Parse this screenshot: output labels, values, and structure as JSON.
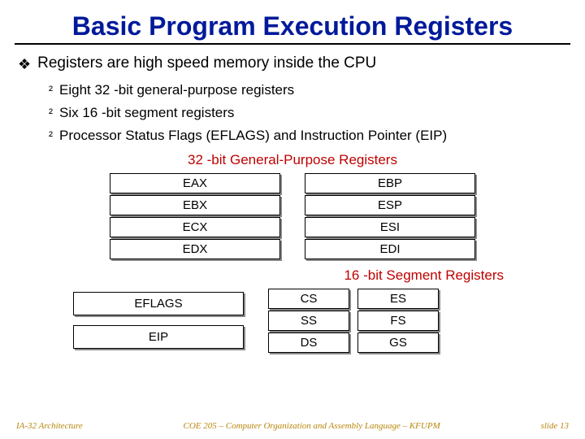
{
  "title": "Basic Program Execution Registers",
  "bullets": {
    "lvl1": "Registers are high speed memory inside the CPU",
    "sub1": "Eight 32 -bit general-purpose registers",
    "sub2": "Six 16 -bit segment registers",
    "sub3": "Processor Status Flags (EFLAGS) and Instruction Pointer (EIP)"
  },
  "sections": {
    "gp": "32 -bit General-Purpose Registers",
    "seg": "16 -bit Segment Registers"
  },
  "gp_left": [
    "EAX",
    "EBX",
    "ECX",
    "EDX"
  ],
  "gp_right": [
    "EBP",
    "ESP",
    "ESI",
    "EDI"
  ],
  "status": {
    "eflags": "EFLAGS",
    "eip": "EIP"
  },
  "seg_left": [
    "CS",
    "SS",
    "DS"
  ],
  "seg_right": [
    "ES",
    "FS",
    "GS"
  ],
  "footer": {
    "left": "IA-32 Architecture",
    "center": "COE 205 – Computer Organization and Assembly Language – KFUPM",
    "right": "slide 13"
  }
}
